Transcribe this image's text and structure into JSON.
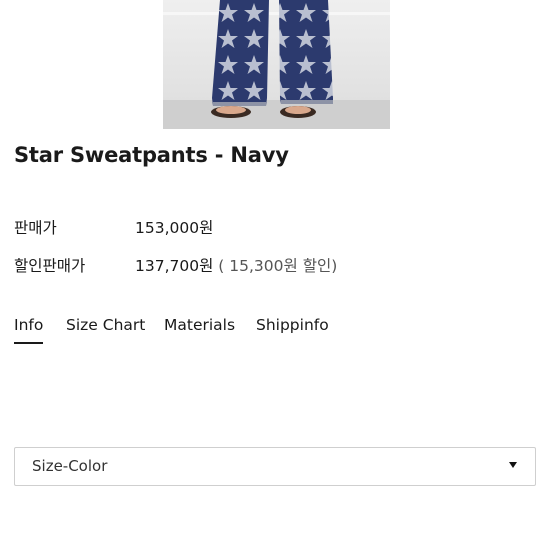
{
  "product": {
    "image_icon": "product-photo-star-sweatpants",
    "title": "Star Sweatpants - Navy"
  },
  "pricing": {
    "list_price_label": "판매가",
    "list_price": "153,000원",
    "sale_price_label": "할인판매가",
    "sale_price": "137,700원",
    "discount_note": "( 15,300원 할인)"
  },
  "tabs": [
    {
      "label": "Info",
      "active": true
    },
    {
      "label": "Size Chart",
      "active": false
    },
    {
      "label": "Materials",
      "active": false
    },
    {
      "label": "Shippinfo",
      "active": false
    }
  ],
  "option_select": {
    "value": "Size-Color",
    "icon": "dropdown-arrow-icon"
  },
  "colors": {
    "pants_navy": "#2c3a6e",
    "star_gray": "#b9bfd0",
    "text": "#1a1a1a"
  }
}
